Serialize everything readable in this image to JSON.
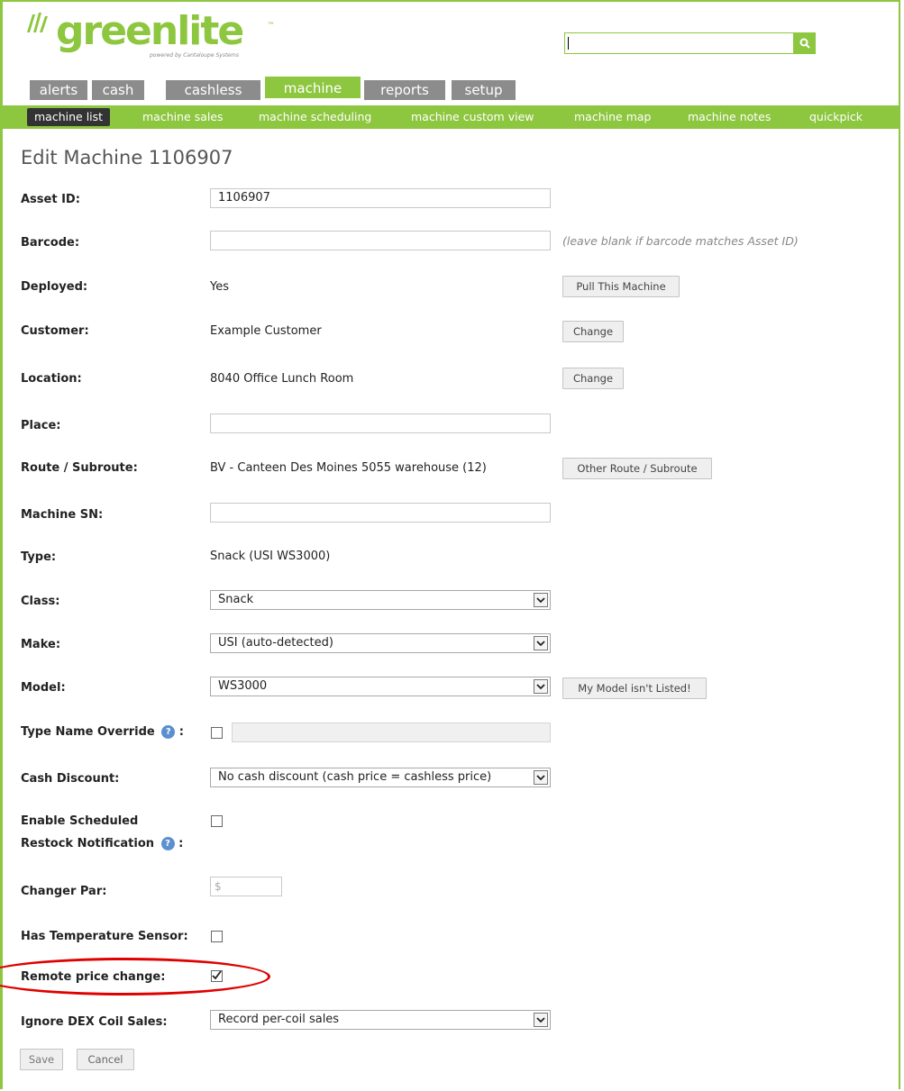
{
  "brand": {
    "name": "greenlite",
    "tm": "™",
    "powered_by": "powered by Cantaloupe Systems"
  },
  "search": {
    "placeholder": ""
  },
  "tabs": [
    {
      "label": "alerts"
    },
    {
      "label": "cash"
    },
    {
      "label": "cashless"
    },
    {
      "label": "machine",
      "active": true
    },
    {
      "label": "reports"
    },
    {
      "label": "setup"
    }
  ],
  "subnav": [
    {
      "label": "machine list",
      "active": true
    },
    {
      "label": "machine sales"
    },
    {
      "label": "machine scheduling"
    },
    {
      "label": "machine custom view"
    },
    {
      "label": "machine map"
    },
    {
      "label": "machine notes"
    },
    {
      "label": "quickpick"
    }
  ],
  "page_title": "Edit Machine 1106907",
  "form": {
    "asset_id": {
      "label": "Asset ID:",
      "value": "1106907"
    },
    "barcode": {
      "label": "Barcode:",
      "value": "",
      "hint": "(leave blank if barcode matches Asset ID)"
    },
    "deployed": {
      "label": "Deployed:",
      "value": "Yes",
      "button": "Pull This Machine"
    },
    "customer": {
      "label": "Customer:",
      "value": "Example Customer",
      "button": "Change"
    },
    "location": {
      "label": "Location:",
      "value": "8040 Office Lunch Room",
      "button": "Change"
    },
    "place": {
      "label": "Place:",
      "value": ""
    },
    "route": {
      "label": "Route / Subroute:",
      "value": "BV - Canteen Des Moines 5055 warehouse (12)",
      "button": "Other Route / Subroute"
    },
    "machine_sn": {
      "label": "Machine SN:",
      "value": ""
    },
    "type": {
      "label": "Type:",
      "value": "Snack (USI WS3000)"
    },
    "class": {
      "label": "Class:",
      "value": "Snack"
    },
    "make": {
      "label": "Make:",
      "value": "USI (auto-detected)"
    },
    "model": {
      "label": "Model:",
      "value": "WS3000",
      "button": "My Model isn't Listed!"
    },
    "type_name_override": {
      "label": "Type Name Override",
      "suffix": ":",
      "checked": false,
      "value": ""
    },
    "cash_discount": {
      "label": "Cash Discount:",
      "value": "No cash discount (cash price = cashless price)"
    },
    "scheduled_restock": {
      "label_line1": "Enable Scheduled",
      "label_line2": "Restock Notification",
      "suffix": ":",
      "checked": false
    },
    "changer_par": {
      "label": "Changer Par:",
      "placeholder": "$"
    },
    "temp_sensor": {
      "label": "Has Temperature Sensor:",
      "checked": false
    },
    "remote_price_change": {
      "label": "Remote price change:",
      "checked": true
    },
    "ignore_dex": {
      "label": "Ignore DEX Coil Sales:",
      "value": "Record per-coil sales"
    }
  },
  "actions": {
    "save": "Save",
    "cancel": "Cancel"
  },
  "colors": {
    "brand_green": "#8dc63f",
    "tab_gray": "#8c8c8c",
    "annotation_red": "#e00000"
  }
}
